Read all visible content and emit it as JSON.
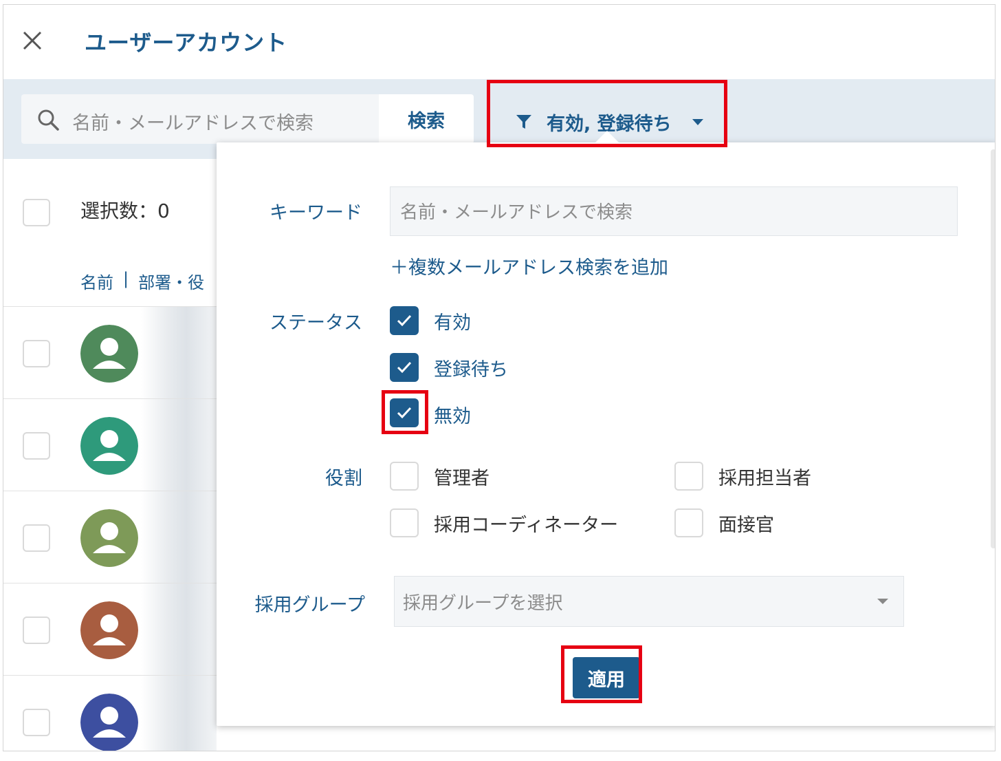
{
  "header": {
    "title": "ユーザーアカウント",
    "close_icon": "close-icon"
  },
  "toolbar": {
    "search_placeholder": "名前・メールアドレスで検索",
    "search_button": "検索",
    "filter_summary": "有効, 登録待ち",
    "filter_icon": "funnel-icon"
  },
  "list": {
    "selection_count": "選択数：0",
    "columns": [
      "名前",
      "部署・役"
    ],
    "column_separator": "|",
    "avatar_colors": [
      "#4f8a5b",
      "#2e9a7b",
      "#7e9a58",
      "#a85d40",
      "#3d4fa0"
    ]
  },
  "filter_panel": {
    "keyword_label": "キーワード",
    "keyword_placeholder": "名前・メールアドレスで検索",
    "add_multi_email": "＋複数メールアドレス検索を追加",
    "status_label": "ステータス",
    "status_options": [
      {
        "label": "有効",
        "checked": true
      },
      {
        "label": "登録待ち",
        "checked": true
      },
      {
        "label": "無効",
        "checked": true
      }
    ],
    "role_label": "役割",
    "role_options": [
      {
        "label": "管理者",
        "checked": false
      },
      {
        "label": "採用担当者",
        "checked": false
      },
      {
        "label": "採用コーディネーター",
        "checked": false
      },
      {
        "label": "面接官",
        "checked": false
      }
    ],
    "group_label": "採用グループ",
    "group_placeholder": "採用グループを選択",
    "apply_button": "適用"
  },
  "colors": {
    "primary": "#1d5b8c",
    "toolbar_bg": "#e3ebf2",
    "highlight": "#e60012"
  }
}
